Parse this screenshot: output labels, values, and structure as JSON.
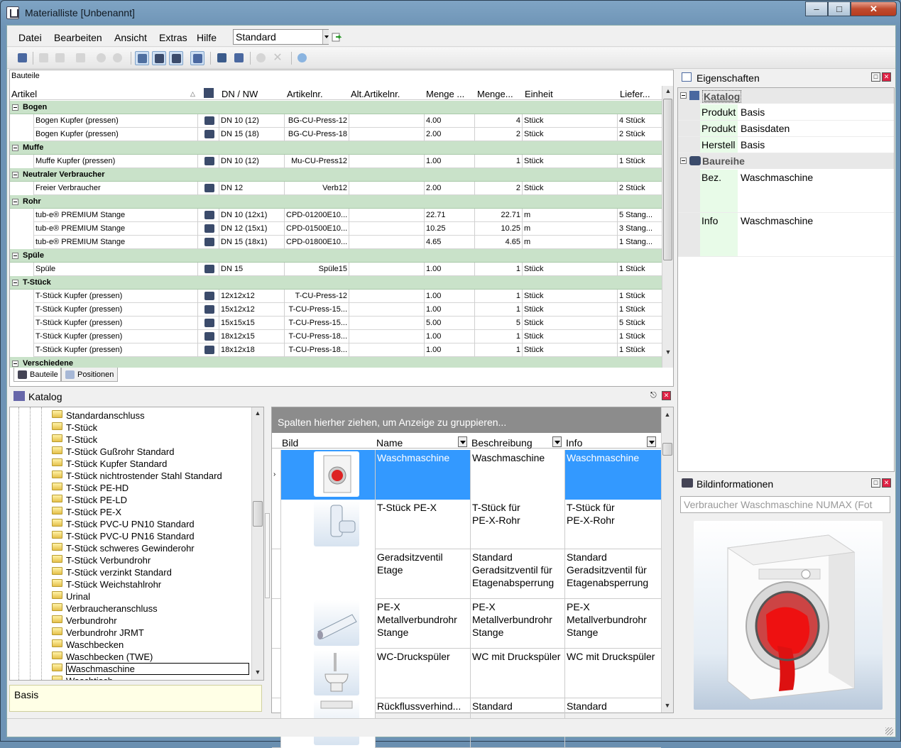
{
  "window": {
    "title": "Materialliste [Unbenannt]"
  },
  "menu": {
    "items": [
      "Datei",
      "Bearbeiten",
      "Ansicht",
      "Extras",
      "Hilfe"
    ],
    "layout_value": "Standard"
  },
  "parts": {
    "caption": "Bauteile",
    "columns": [
      "Artikel",
      "DN / NW",
      "Artikelnr.",
      "Alt.Artikelnr.",
      "Menge ...",
      "Menge...",
      "Einheit",
      "Liefer..."
    ],
    "rows": [
      {
        "group": "Bogen"
      },
      {
        "artikel": "Bogen Kupfer (pressen)",
        "dn": "DN 10 (12)",
        "nr": "BG-CU-Press-12",
        "alt": "",
        "menge1": "4.00",
        "menge2": "4",
        "einheit": "Stück",
        "liefer": "4 Stück"
      },
      {
        "artikel": "Bogen Kupfer (pressen)",
        "dn": "DN 15 (18)",
        "nr": "BG-CU-Press-18",
        "alt": "",
        "menge1": "2.00",
        "menge2": "2",
        "einheit": "Stück",
        "liefer": "2 Stück"
      },
      {
        "group": "Muffe"
      },
      {
        "artikel": "Muffe Kupfer (pressen)",
        "dn": "DN 10 (12)",
        "nr": "Mu-CU-Press12",
        "alt": "",
        "menge1": "1.00",
        "menge2": "1",
        "einheit": "Stück",
        "liefer": "1 Stück"
      },
      {
        "group": "Neutraler Verbraucher"
      },
      {
        "artikel": "Freier Verbraucher",
        "dn": "DN 12",
        "nr": "Verb12",
        "alt": "",
        "menge1": "2.00",
        "menge2": "2",
        "einheit": "Stück",
        "liefer": "2 Stück"
      },
      {
        "group": "Rohr"
      },
      {
        "artikel": "tub-e® PREMIUM Stange",
        "dn": "DN 10 (12x1)",
        "nr": "CPD-01200E10...",
        "alt": "",
        "menge1": "22.71",
        "menge2": "22.71",
        "einheit": "m",
        "liefer": "5 Stang..."
      },
      {
        "artikel": "tub-e® PREMIUM Stange",
        "dn": "DN 12 (15x1)",
        "nr": "CPD-01500E10...",
        "alt": "",
        "menge1": "10.25",
        "menge2": "10.25",
        "einheit": "m",
        "liefer": "3 Stang..."
      },
      {
        "artikel": "tub-e® PREMIUM Stange",
        "dn": "DN 15 (18x1)",
        "nr": "CPD-01800E10...",
        "alt": "",
        "menge1": "4.65",
        "menge2": "4.65",
        "einheit": "m",
        "liefer": "1 Stang..."
      },
      {
        "group": "Spüle"
      },
      {
        "artikel": "Spüle",
        "dn": "DN 15",
        "nr": "Spüle15",
        "alt": "",
        "menge1": "1.00",
        "menge2": "1",
        "einheit": "Stück",
        "liefer": "1 Stück"
      },
      {
        "group": "T-Stück"
      },
      {
        "artikel": "T-Stück Kupfer (pressen)",
        "dn": "12x12x12",
        "nr": "T-CU-Press-12",
        "alt": "",
        "menge1": "1.00",
        "menge2": "1",
        "einheit": "Stück",
        "liefer": "1 Stück"
      },
      {
        "artikel": "T-Stück Kupfer (pressen)",
        "dn": "15x12x12",
        "nr": "T-CU-Press-15...",
        "alt": "",
        "menge1": "1.00",
        "menge2": "1",
        "einheit": "Stück",
        "liefer": "1 Stück"
      },
      {
        "artikel": "T-Stück Kupfer (pressen)",
        "dn": "15x15x15",
        "nr": "T-CU-Press-15...",
        "alt": "",
        "menge1": "5.00",
        "menge2": "5",
        "einheit": "Stück",
        "liefer": "5 Stück"
      },
      {
        "artikel": "T-Stück Kupfer (pressen)",
        "dn": "18x12x15",
        "nr": "T-CU-Press-18...",
        "alt": "",
        "menge1": "1.00",
        "menge2": "1",
        "einheit": "Stück",
        "liefer": "1 Stück"
      },
      {
        "artikel": "T-Stück Kupfer (pressen)",
        "dn": "18x12x18",
        "nr": "T-CU-Press-18...",
        "alt": "",
        "menge1": "1.00",
        "menge2": "1",
        "einheit": "Stück",
        "liefer": "1 Stück"
      },
      {
        "group": "Verschiedene"
      }
    ],
    "tabs": [
      "Bauteile",
      "Positionen"
    ]
  },
  "catalog": {
    "title": "Katalog",
    "tree_items": [
      "Standardanschluss",
      "T-Stück",
      "T-Stück",
      "T-Stück Gußrohr Standard",
      "T-Stück Kupfer Standard",
      "T-Stück nichtrostender Stahl Standard",
      "T-Stück PE-HD",
      "T-Stück PE-LD",
      "T-Stück PE-X",
      "T-Stück PVC-U PN10 Standard",
      "T-Stück PVC-U PN16 Standard",
      "T-Stück schweres Gewinderohr",
      "T-Stück Verbundrohr",
      "T-Stück verzinkt Standard",
      "T-Stück Weichstahlrohr",
      "Urinal",
      "Verbraucheranschluss",
      "Verbundrohr",
      "Verbundrohr JRMT",
      "Waschbecken",
      "Waschbecken (TWE)",
      "Waschmaschine",
      "Waschtisch"
    ],
    "selected_item": "Waschmaschine",
    "description": "Basis",
    "group_hint": "Spalten hierher ziehen, um Anzeige zu gruppieren...",
    "columns": [
      "Bild",
      "Name",
      "Beschreibung",
      "Info"
    ],
    "rows": [
      {
        "name": "Waschmaschine",
        "beschreibung": "Waschmaschine",
        "info": "Waschmaschine",
        "image": "washing-machine-image"
      },
      {
        "name": "T-Stück PE-X",
        "beschreibung": "T-Stück für\nPE-X-Rohr",
        "info": "T-Stück für\nPE-X-Rohr",
        "image": "tee-fitting-image"
      },
      {
        "name": "Geradsitzventil\nEtage",
        "beschreibung": "Standard\nGeradsitzventil für\nEtagenabsperrung",
        "info": "Standard\nGeradsitzventil für\nEtagenabsperrung",
        "image": ""
      },
      {
        "name": "PE-X\nMetallverbundrohr\nStange",
        "beschreibung": "PE-X\nMetallverbundrohr\nStange",
        "info": "PE-X\nMetallverbundrohr\nStange",
        "image": "pipe-image"
      },
      {
        "name": "WC-Druckspüler",
        "beschreibung": "WC mit Druckspüler",
        "info": "WC mit Druckspüler",
        "image": "toilet-image"
      },
      {
        "name": "Rückflussverhind...",
        "beschreibung": "Standard",
        "info": "Standard",
        "image": "valve-image"
      }
    ]
  },
  "properties": {
    "title": "Eigenschaften",
    "sections": [
      {
        "name": "Katalog",
        "rows": [
          {
            "key": "Produkt",
            "value": "Basis"
          },
          {
            "key": "Produkt",
            "value": "Basisdaten"
          },
          {
            "key": "Herstell",
            "value": "Basis"
          }
        ]
      },
      {
        "name": "Baureihe",
        "rows": [
          {
            "key": "Bez.",
            "value": "Waschmaschine"
          },
          {
            "key": "Info",
            "value": "Waschmaschine"
          }
        ]
      }
    ]
  },
  "image_info": {
    "title": "Bildinformationen",
    "selected": "Verbraucher Waschmaschine NUMAX (Fot"
  },
  "colors": {
    "group_row": "#c9e2c9",
    "selection": "#3399ff",
    "property_key_bg": "#e8fbe8"
  }
}
